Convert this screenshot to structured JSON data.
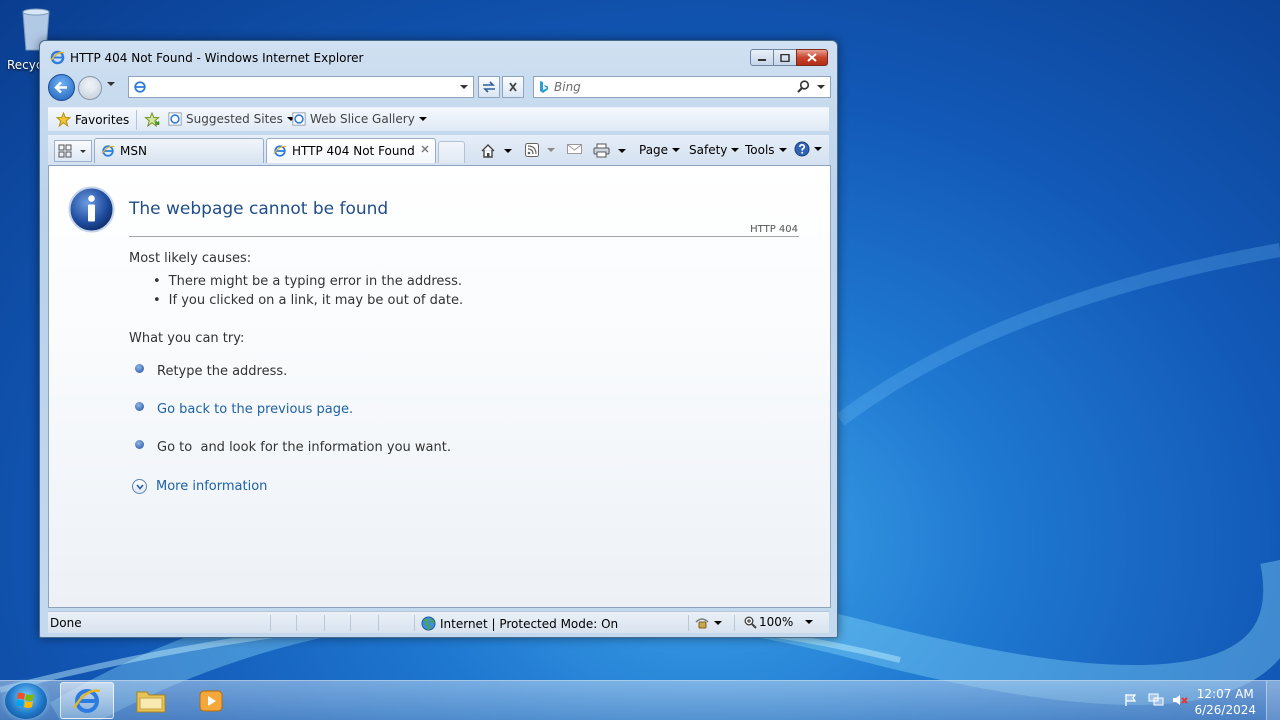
{
  "desktop": {
    "recycle_bin_label": "Recyc"
  },
  "window": {
    "title": "HTTP 404 Not Found - Windows Internet Explorer",
    "address": {
      "value": ""
    },
    "search": {
      "placeholder": "Bing"
    }
  },
  "favorites_bar": {
    "favorites_label": "Favorites",
    "items": [
      {
        "label": "Suggested Sites"
      },
      {
        "label": "Web Slice Gallery"
      }
    ]
  },
  "tabs": [
    {
      "label": "MSN"
    },
    {
      "label": "HTTP 404 Not Found"
    }
  ],
  "command_bar": {
    "page_label": "Page",
    "safety_label": "Safety",
    "tools_label": "Tools"
  },
  "page": {
    "title": "The webpage cannot be found",
    "code": "HTTP 404",
    "causes_heading": "Most likely causes:",
    "causes": [
      "There might be a typing error in the address.",
      "If you clicked on a link, it may be out of date."
    ],
    "try_heading": "What you can try:",
    "try_items": [
      {
        "text": "Retype the address."
      },
      {
        "text": "Go back to the previous page."
      },
      {
        "text": "Go to  and look for the information you want."
      }
    ],
    "more_info": "More information"
  },
  "status_bar": {
    "status": "Done",
    "zone": "Internet | Protected Mode: On",
    "zoom": "100%"
  },
  "taskbar": {
    "time": "12:07 AM",
    "date": "6/26/2024"
  },
  "colors": {
    "link": "#1d62a6",
    "title": "#1f4e8a",
    "close_button": "#c9452c"
  }
}
